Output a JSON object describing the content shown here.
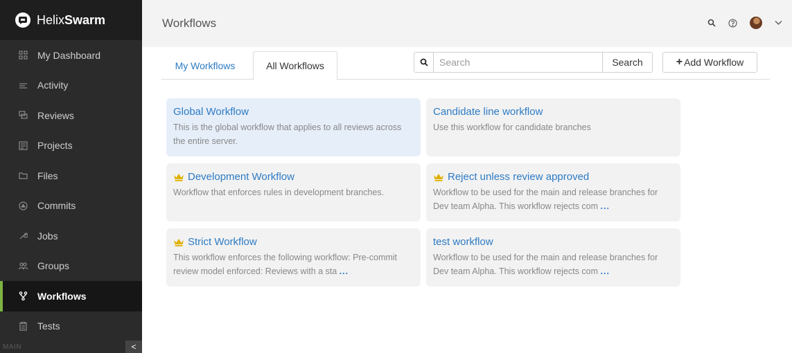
{
  "brand": {
    "prefix": "Helix",
    "name": "Swarm"
  },
  "nav": {
    "items": [
      {
        "label": "My Dashboard",
        "icon": "dashboard-icon"
      },
      {
        "label": "Activity",
        "icon": "activity-icon"
      },
      {
        "label": "Reviews",
        "icon": "reviews-icon"
      },
      {
        "label": "Projects",
        "icon": "projects-icon"
      },
      {
        "label": "Files",
        "icon": "folder-icon"
      },
      {
        "label": "Commits",
        "icon": "commit-icon"
      },
      {
        "label": "Jobs",
        "icon": "wrench-icon"
      },
      {
        "label": "Groups",
        "icon": "groups-icon"
      },
      {
        "label": "Workflows",
        "icon": "workflow-icon",
        "active": true
      },
      {
        "label": "Tests",
        "icon": "tests-icon"
      }
    ],
    "footer_label": "MAIN",
    "collapse_glyph": "<"
  },
  "header": {
    "title": "Workflows"
  },
  "tabs": {
    "my": "My Workflows",
    "all": "All Workflows"
  },
  "search": {
    "placeholder": "Search",
    "button": "Search"
  },
  "add_button": {
    "plus": "+",
    "label": "Add Workflow"
  },
  "workflows": [
    {
      "title": "Global Workflow",
      "desc": "This is the global workflow that applies to all reviews across the entire server.",
      "crown": false,
      "selected": true,
      "more": ""
    },
    {
      "title": "Candidate line workflow",
      "desc": "Use this workflow for candidate branches",
      "crown": false,
      "selected": false,
      "more": ""
    },
    {
      "title": "Development Workflow",
      "desc": "Workflow that enforces rules in development branches.",
      "crown": true,
      "selected": false,
      "more": ""
    },
    {
      "title": "Reject unless review approved",
      "desc": "Workflow to be used for the main and release branches for Dev team Alpha. This workflow rejects com",
      "crown": true,
      "selected": false,
      "more": "..."
    },
    {
      "title": "Strict Workflow",
      "desc": "This workflow enforces the following workflow: Pre-commit review model enforced: Reviews with a sta",
      "crown": true,
      "selected": false,
      "more": "..."
    },
    {
      "title": "test workflow",
      "desc": "Workflow to be used for the main and release branches for Dev team Alpha. This workflow rejects com",
      "crown": false,
      "selected": false,
      "more": "..."
    }
  ],
  "colors": {
    "accent": "#2d7bc4",
    "active_bar": "#7cb342",
    "crown": "#e0b100",
    "selected_card": "#e6eef9"
  }
}
